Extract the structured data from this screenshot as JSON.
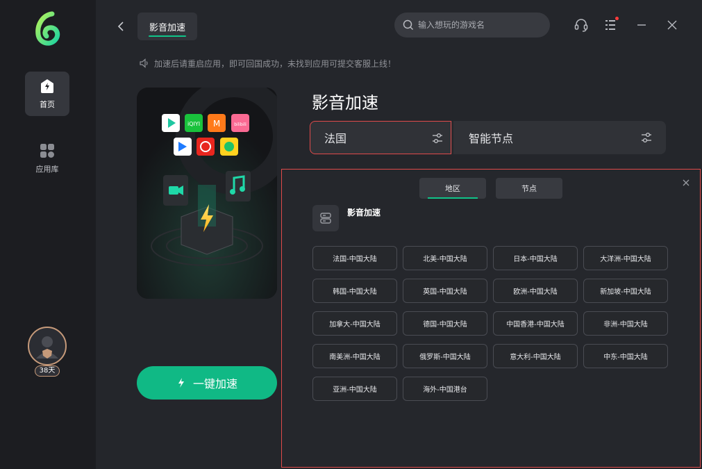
{
  "sidebar": {
    "logo_icon": "app-logo-icon",
    "items": [
      {
        "label": "首页",
        "icon": "home-lightning-icon",
        "active": true
      },
      {
        "label": "应用库",
        "icon": "grid-apps-icon",
        "active": false
      }
    ],
    "user": {
      "days_badge": "38天"
    }
  },
  "header": {
    "back_icon": "chevron-left-icon",
    "active_tab": "影音加速",
    "search": {
      "placeholder": "输入想玩的游戏名",
      "value": ""
    },
    "icons": [
      "headset-support-icon",
      "menu-list-icon",
      "minimize-icon",
      "close-icon"
    ]
  },
  "notice": {
    "text": "加速后请重启应用，即可回国成功，未找到应用可提交客服上线！"
  },
  "main": {
    "title": "影音加速",
    "region_value": "法国",
    "node_value": "智能节点",
    "accelerate_label": "一键加速"
  },
  "dropdown": {
    "tabs": [
      "地区",
      "节点"
    ],
    "active_tab": 0,
    "game_name": "影音加速",
    "regions": [
      "法国-中国大陆",
      "北美-中国大陆",
      "日本-中国大陆",
      "大洋洲-中国大陆",
      "韩国-中国大陆",
      "英国-中国大陆",
      "欧洲-中国大陆",
      "新加坡-中国大陆",
      "加拿大-中国大陆",
      "德国-中国大陆",
      "中国香港-中国大陆",
      "非洲-中国大陆",
      "南美洲-中国大陆",
      "俄罗斯-中国大陆",
      "意大利-中国大陆",
      "中东-中国大陆",
      "亚洲-中国大陆",
      "海外-中国港台"
    ]
  },
  "colors": {
    "accent": "#10b985",
    "highlight_border": "#e04a4a",
    "background": "#24262b",
    "sidebar": "#1c1d21"
  }
}
